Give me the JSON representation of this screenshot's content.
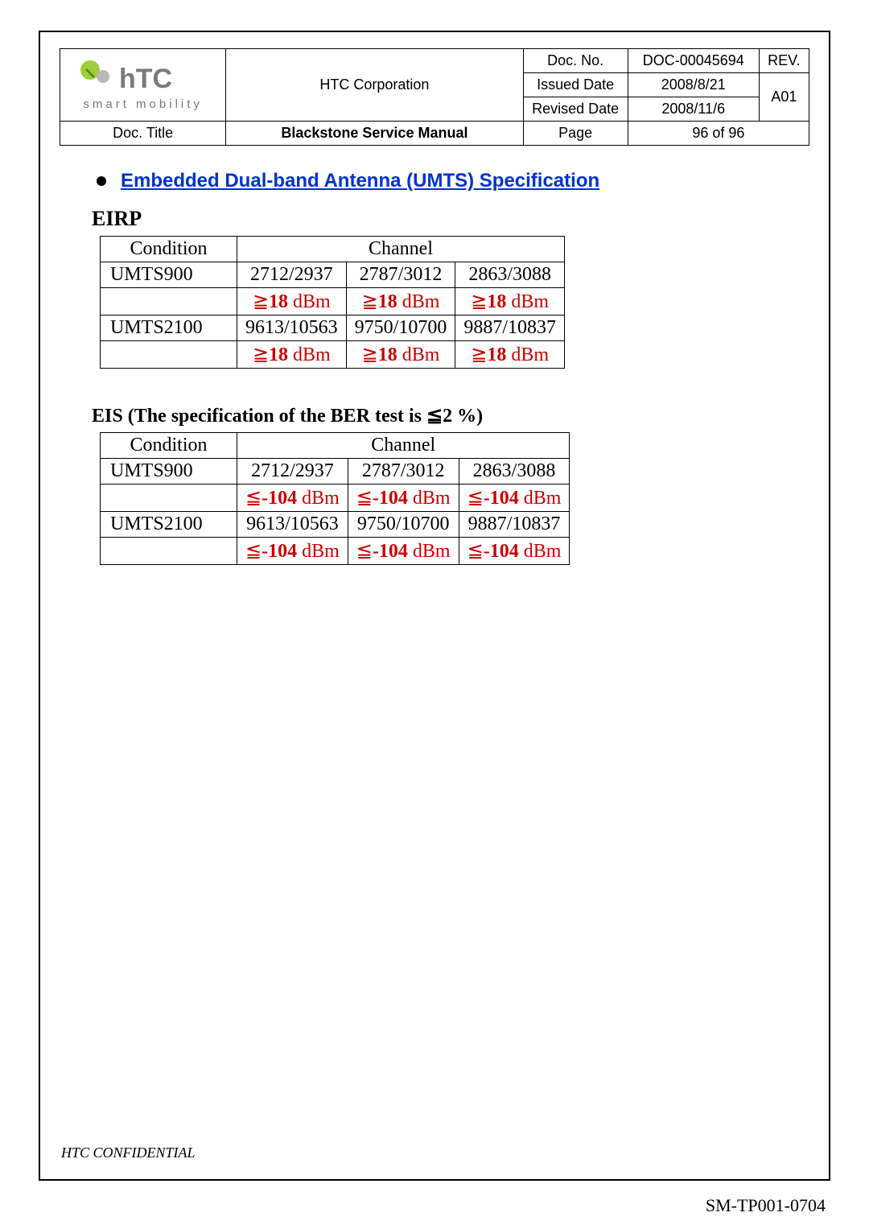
{
  "logo": {
    "word": "hTC",
    "tagline": "smart mobility"
  },
  "header": {
    "corp": "HTC Corporation",
    "doc_no_label": "Doc. No.",
    "doc_no": "DOC-00045694",
    "rev_label": "REV.",
    "issued_label": "Issued Date",
    "issued": "2008/8/21",
    "rev": "A01",
    "revised_label": "Revised Date",
    "revised": "2008/11/6",
    "title_label": "Doc. Title",
    "title": "Blackstone Service Manual",
    "page_label": "Page",
    "page": "96  of  96"
  },
  "section_link": "Embedded Dual-band Antenna (UMTS) Specification",
  "eirp": {
    "heading": "EIRP",
    "condition_label": "Condition",
    "channel_label": "Channel",
    "rows": [
      {
        "band": "UMTS900",
        "ch": [
          "2712/2937",
          "2787/3012",
          "2863/3088"
        ]
      },
      {
        "val_prefix": "≧",
        "val_bold": "18",
        "val_unit": " dBm"
      },
      {
        "band": "UMTS2100",
        "ch": [
          "9613/10563",
          "9750/10700",
          "9887/10837"
        ]
      },
      {
        "val_prefix": "≧",
        "val_bold": "18",
        "val_unit": " dBm"
      }
    ]
  },
  "eis": {
    "heading": "EIS (The specification of the BER test is ≦2 %)",
    "condition_label": "Condition",
    "channel_label": "Channel",
    "rows": [
      {
        "band": "UMTS900",
        "ch": [
          "2712/2937",
          "2787/3012",
          "2863/3088"
        ]
      },
      {
        "val_prefix": "≦",
        "val_bold": "-104",
        "val_unit": " dBm"
      },
      {
        "band": "UMTS2100",
        "ch": [
          "9613/10563",
          "9750/10700",
          "9887/10837"
        ]
      },
      {
        "val_prefix": "≦",
        "val_bold": "-104",
        "val_unit": " dBm"
      }
    ]
  },
  "footer": {
    "confidential": "HTC CONFIDENTIAL",
    "code": "SM-TP001-0704"
  }
}
